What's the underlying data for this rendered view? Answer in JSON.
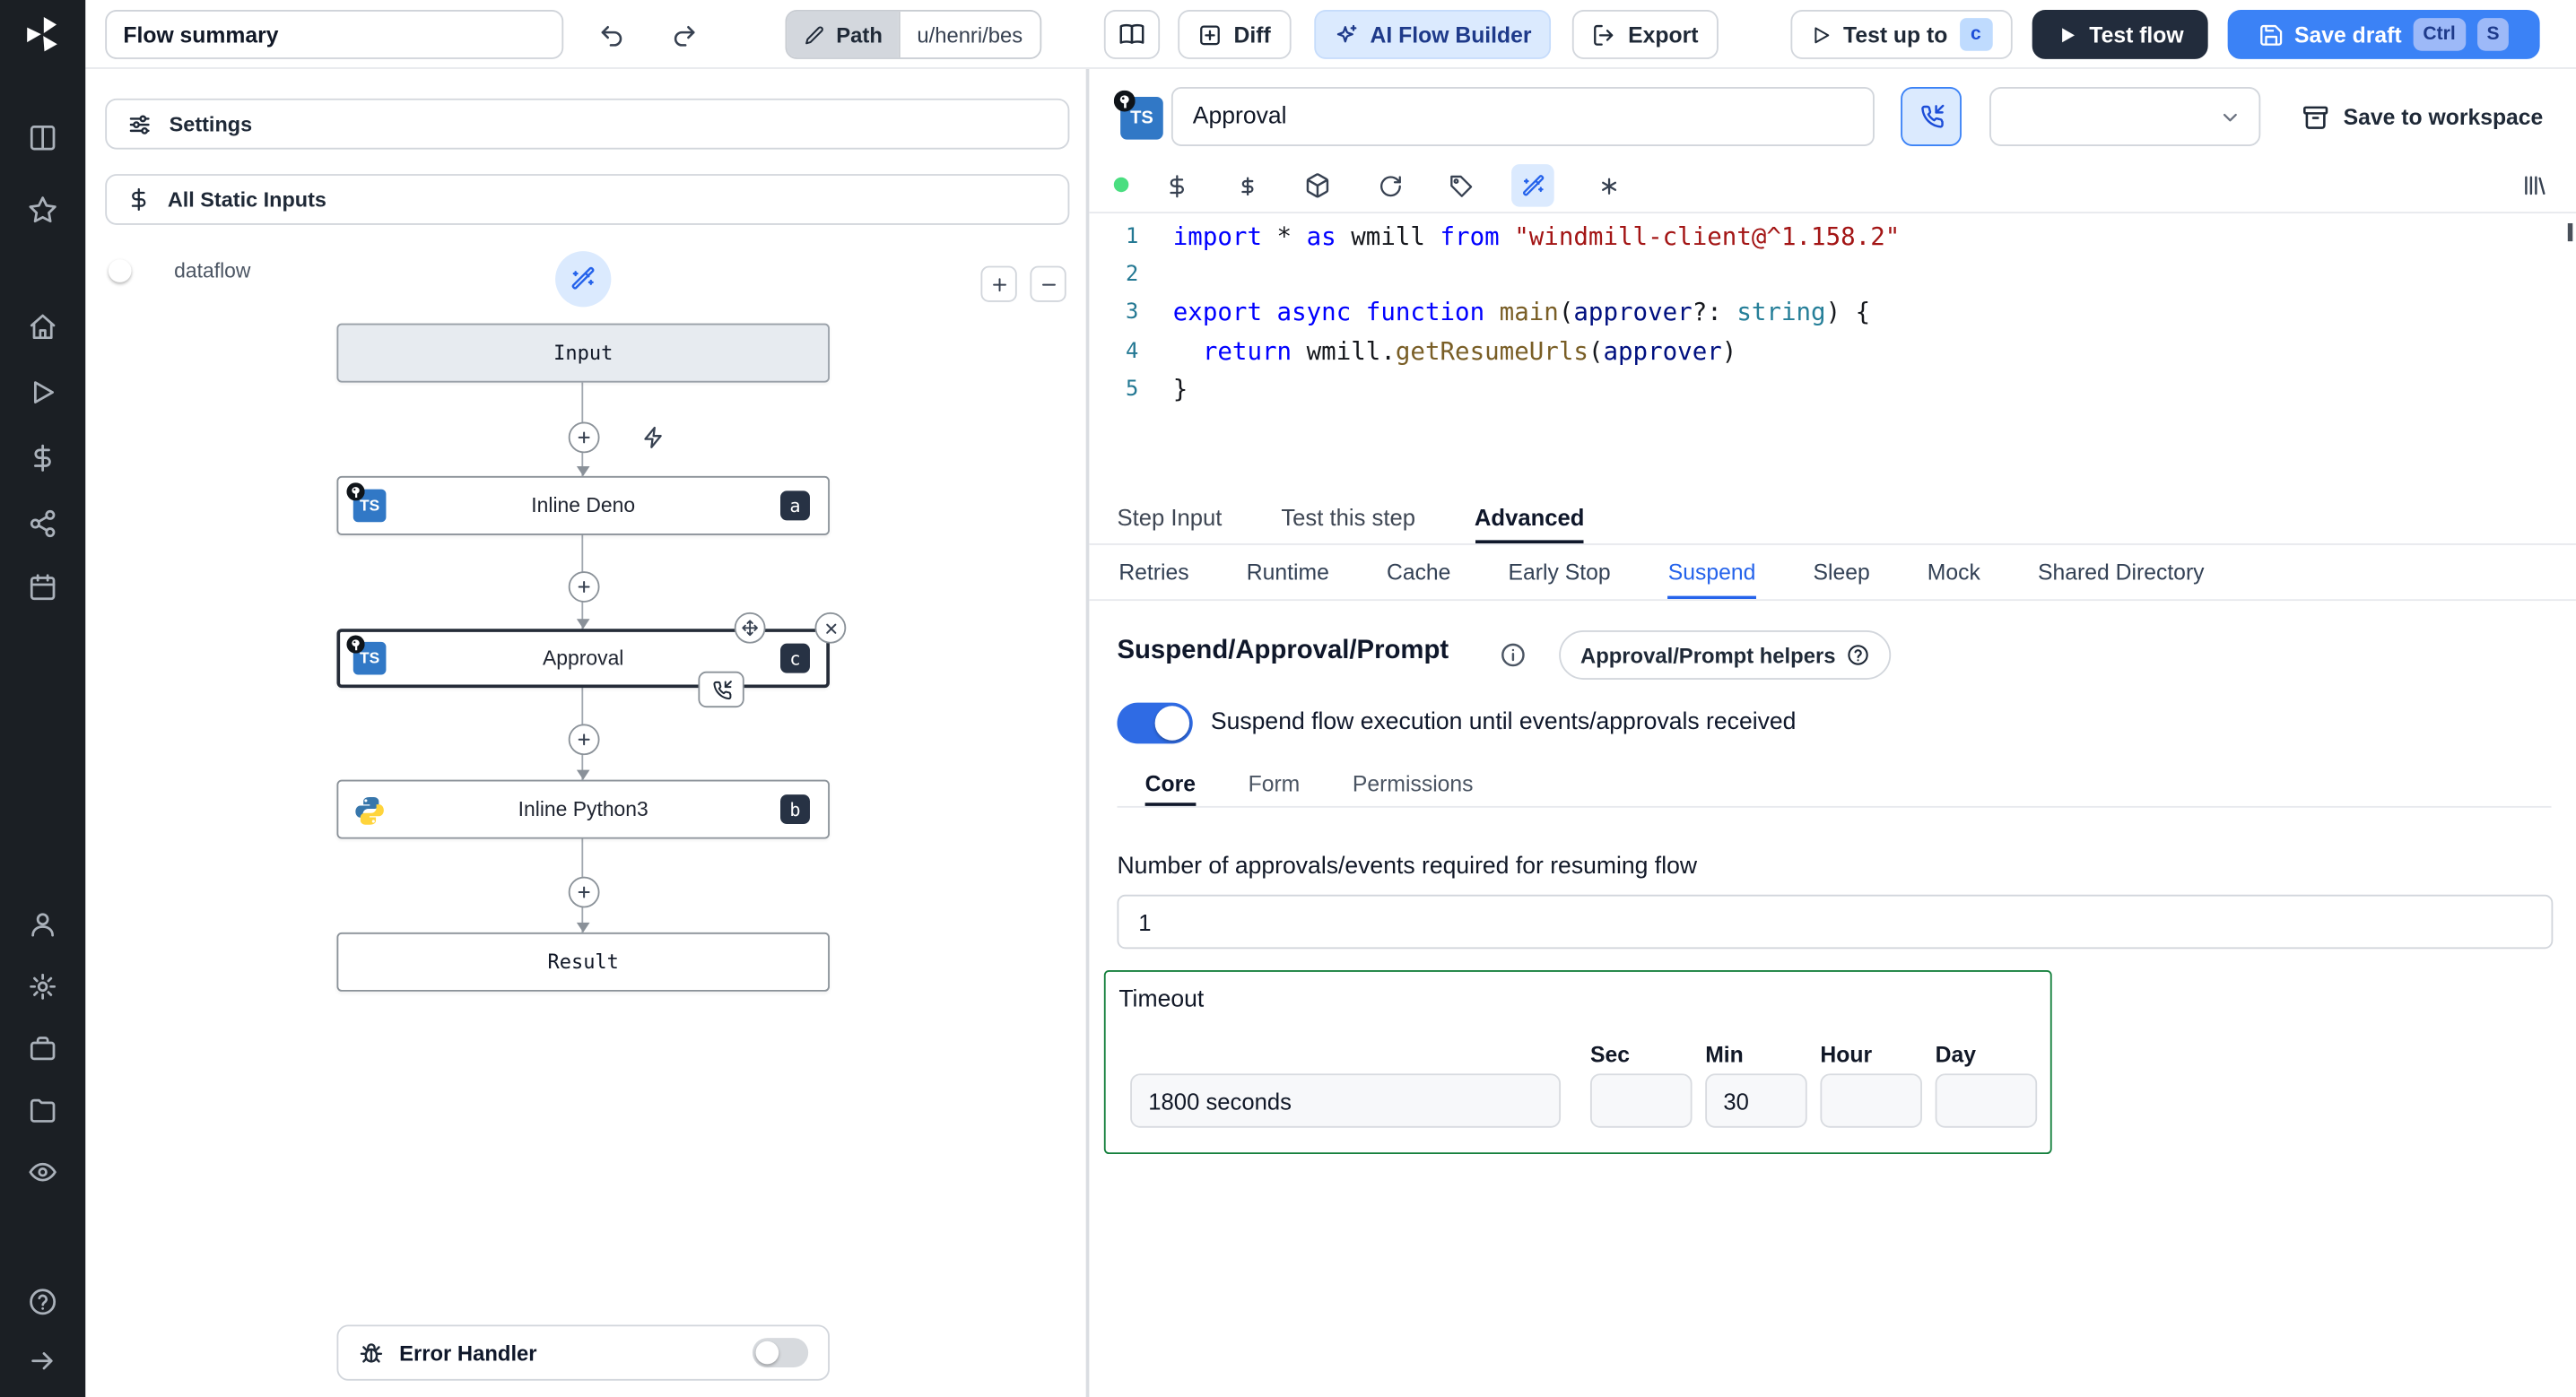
{
  "colors": {
    "accent": "#3b82f6",
    "accent-deep": "#2563eb",
    "light-blue": "#dbeafe",
    "dark-button": "#222c3c",
    "badge-navy": "#273244",
    "status-green": "#4ade80",
    "timeout-border": "#15803d",
    "sidebar-bg": "#1b1f24",
    "toggle-on": "#2f6be4"
  },
  "sidebar": {
    "icons": [
      "windmill-logo",
      "board",
      "favorites",
      "home",
      "runs",
      "variables",
      "resources",
      "schedules",
      "users",
      "workspace-settings",
      "workers",
      "folders",
      "audit-logs",
      "help",
      "collapse"
    ]
  },
  "topbar": {
    "flow_summary": "Flow summary",
    "path": {
      "label": "Path",
      "value": "u/henri/bes"
    },
    "diff": "Diff",
    "ai_flow_builder": "AI Flow Builder",
    "export": "Export",
    "test_up_to": {
      "label": "Test up to",
      "badge": "c"
    },
    "test_flow": "Test flow",
    "save_draft": {
      "label": "Save draft",
      "kbd": [
        "Ctrl",
        "S"
      ]
    }
  },
  "flow_panel": {
    "settings": "Settings",
    "all_static_inputs": "All Static Inputs",
    "dataflow": "dataflow",
    "graph": {
      "input": "Input",
      "result": "Result",
      "steps": [
        {
          "title": "Inline Deno",
          "badge": "a",
          "lang": "typescript"
        },
        {
          "title": "Approval",
          "badge": "c",
          "lang": "typescript",
          "selected": true
        },
        {
          "title": "Inline Python3",
          "badge": "b",
          "lang": "python"
        }
      ]
    },
    "error_handler": "Error Handler"
  },
  "editor": {
    "step_name": "Approval",
    "save_to_workspace": "Save to workspace",
    "code": [
      {
        "tokens": [
          {
            "c": "kw",
            "t": "import"
          },
          {
            "c": "pl",
            "t": " * "
          },
          {
            "c": "kw",
            "t": "as"
          },
          {
            "c": "pl",
            "t": " wmill "
          },
          {
            "c": "kw",
            "t": "from"
          },
          {
            "c": "pl",
            "t": " "
          },
          {
            "c": "str",
            "t": "\"windmill-client@^1.158.2\""
          }
        ]
      },
      {
        "tokens": []
      },
      {
        "tokens": [
          {
            "c": "kw",
            "t": "export"
          },
          {
            "c": "pl",
            "t": " "
          },
          {
            "c": "kw",
            "t": "async"
          },
          {
            "c": "pl",
            "t": " "
          },
          {
            "c": "kw",
            "t": "function"
          },
          {
            "c": "pl",
            "t": " "
          },
          {
            "c": "fn",
            "t": "main"
          },
          {
            "c": "pl",
            "t": "("
          },
          {
            "c": "prm",
            "t": "approver"
          },
          {
            "c": "pl",
            "t": "?: "
          },
          {
            "c": "typ",
            "t": "string"
          },
          {
            "c": "pl",
            "t": ") {"
          }
        ]
      },
      {
        "tokens": [
          {
            "c": "pl",
            "t": "  "
          },
          {
            "c": "kw",
            "t": "return"
          },
          {
            "c": "pl",
            "t": " wmill."
          },
          {
            "c": "fn",
            "t": "getResumeUrls"
          },
          {
            "c": "pl",
            "t": "("
          },
          {
            "c": "prm",
            "t": "approver"
          },
          {
            "c": "pl",
            "t": ")"
          }
        ]
      },
      {
        "tokens": [
          {
            "c": "pl",
            "t": "}"
          }
        ]
      }
    ]
  },
  "tabs": {
    "main": [
      "Step Input",
      "Test this step",
      "Advanced"
    ],
    "main_selected": "Advanced",
    "advanced": [
      "Retries",
      "Runtime",
      "Cache",
      "Early Stop",
      "Suspend",
      "Sleep",
      "Mock",
      "Shared Directory"
    ],
    "advanced_selected": "Suspend"
  },
  "suspend": {
    "title": "Suspend/Approval/Prompt",
    "helpers_button": "Approval/Prompt helpers",
    "toggle_label": "Suspend flow execution until events/approvals received",
    "tabs": [
      "Core",
      "Form",
      "Permissions"
    ],
    "tabs_selected": "Core",
    "approvals_label": "Number of approvals/events required for resuming flow",
    "approvals_value": "1",
    "timeout": {
      "label": "Timeout",
      "value": "1800 seconds",
      "units": [
        "Sec",
        "Min",
        "Hour",
        "Day"
      ],
      "unit_values": [
        "",
        "30",
        "",
        ""
      ]
    }
  }
}
